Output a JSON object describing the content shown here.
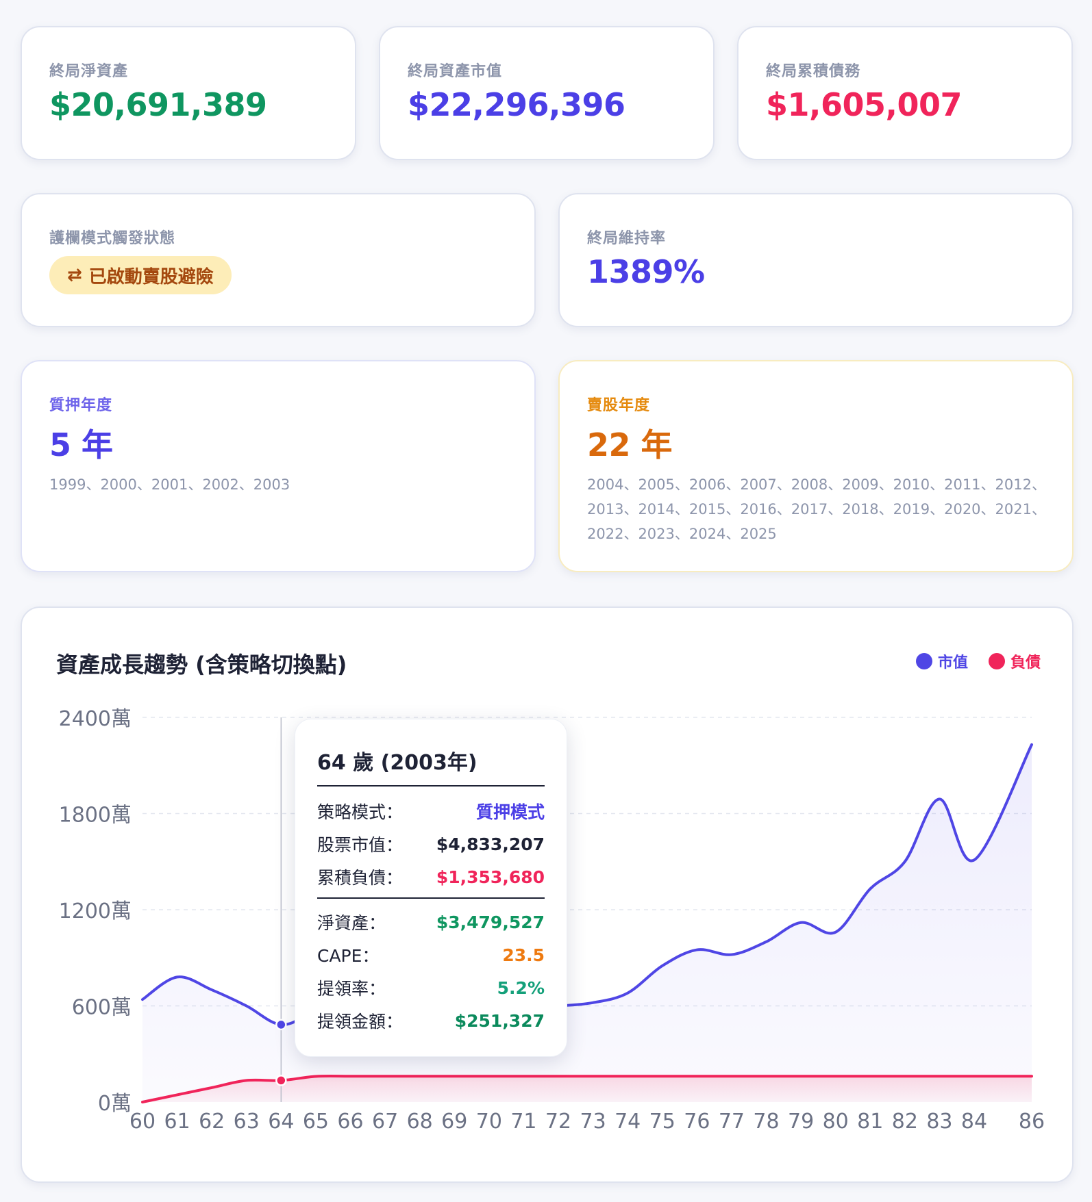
{
  "stats": [
    {
      "label": "終局淨資產",
      "value": "$20,691,389",
      "color": "#0f9660"
    },
    {
      "label": "終局資產市值",
      "value": "$22,296,396",
      "color": "#4b3fe6"
    },
    {
      "label": "終局累積債務",
      "value": "$1,605,007",
      "color": "#f0245a"
    }
  ],
  "guard": {
    "label": "護欄模式觸發狀態",
    "icon": "swap-arrows-icon",
    "icon_glyph": "⇄",
    "badge": "已啟動賣股避險"
  },
  "maintenance": {
    "label": "終局維持率",
    "value": "1389%"
  },
  "pledge": {
    "label": "質押年度",
    "value": "5 年",
    "years": "1999、2000、2001、2002、2003"
  },
  "sell": {
    "label": "賣股年度",
    "value": "22 年",
    "years": "2004、2005、2006、2007、2008、2009、2010、2011、2012、2013、2014、2015、2016、2017、2018、2019、2020、2021、2022、2023、2024、2025"
  },
  "chart": {
    "title": "資產成長趨勢 (含策略切換點)",
    "legend": [
      {
        "label": "市值",
        "color": "#4f46e5"
      },
      {
        "label": "負債",
        "color": "#f0245a"
      }
    ]
  },
  "chart_data": {
    "type": "area",
    "x": [
      60,
      61,
      62,
      63,
      64,
      65,
      66,
      67,
      68,
      69,
      70,
      71,
      72,
      73,
      74,
      75,
      76,
      77,
      78,
      79,
      80,
      81,
      82,
      83,
      84,
      86
    ],
    "x_tick_labels": [
      "60",
      "61",
      "62",
      "63",
      "64",
      "65",
      "66",
      "67",
      "68",
      "69",
      "70",
      "71",
      "72",
      "73",
      "74",
      "75",
      "76",
      "77",
      "78",
      "79",
      "80",
      "81",
      "82",
      "83",
      "84",
      "86"
    ],
    "y_tick_labels": [
      "0萬",
      "600萬",
      "1200萬",
      "1800萬",
      "2400萬"
    ],
    "y_ticks": [
      0,
      600,
      1200,
      1800,
      2400
    ],
    "ylim": [
      0,
      2400
    ],
    "y_unit": "萬",
    "grid": true,
    "legend_position": "top-right",
    "series": [
      {
        "name": "市值",
        "color": "#4f46e5",
        "values": [
          640,
          780,
          700,
          600,
          483,
          560,
          590,
          600,
          610,
          605,
          600,
          595,
          600,
          620,
          680,
          850,
          950,
          920,
          1000,
          1120,
          1060,
          1330,
          1500,
          1890,
          1510,
          2230
        ]
      },
      {
        "name": "負債",
        "color": "#f0245a",
        "values": [
          0,
          45,
          90,
          135,
          135,
          160,
          161,
          161,
          161,
          161,
          161,
          161,
          161,
          161,
          161,
          161,
          161,
          161,
          161,
          161,
          161,
          161,
          161,
          161,
          161,
          161
        ]
      }
    ],
    "highlight_x": 64
  },
  "tooltip": {
    "title": "64 歲 (2003年)",
    "rows": [
      {
        "key": "策略模式：",
        "value": "質押模式",
        "color": "#4b3fe6"
      },
      {
        "key": "股票市值：",
        "value": "$4,833,207",
        "color": "#1e2235"
      },
      {
        "key": "累積負債：",
        "value": "$1,353,680",
        "color": "#f0245a"
      },
      {
        "key": "淨資產：",
        "value": "$3,479,527",
        "color": "#0f9660"
      },
      {
        "key": "CAPE：",
        "value": "23.5",
        "color": "#ee7a10"
      },
      {
        "key": "提領率：",
        "value": "5.2%",
        "color": "#14a07a"
      },
      {
        "key": "提領金額：",
        "value": "$251,327",
        "color": "#0b8a5c"
      }
    ]
  }
}
